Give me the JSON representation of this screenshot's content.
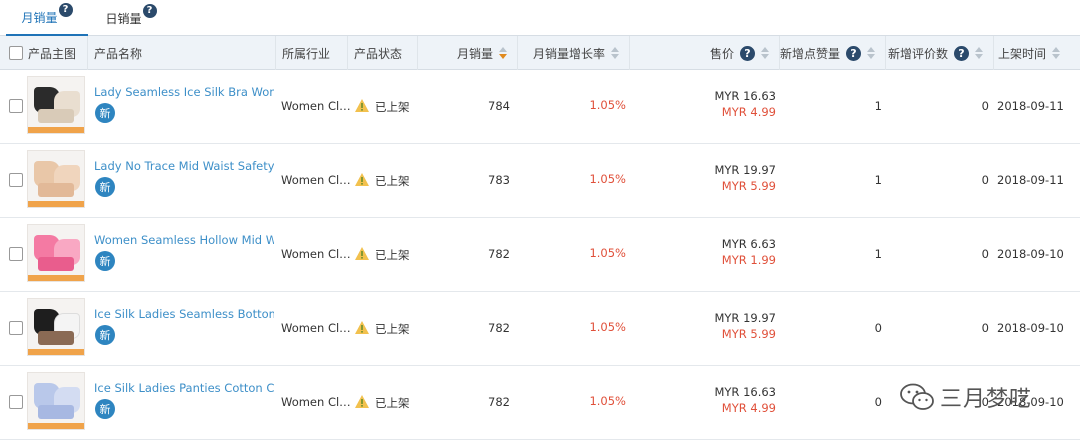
{
  "tabs": [
    {
      "label": "月销量",
      "active": true
    },
    {
      "label": "日销量",
      "active": false
    }
  ],
  "help_glyph": "?",
  "columns": {
    "image": "产品主图",
    "name": "产品名称",
    "industry": "所属行业",
    "status": "产品状态",
    "monthly_sales": "月销量",
    "growth": "月销量增长率",
    "price": "售价",
    "new_likes": "新增点赞量",
    "new_reviews": "新增评价数",
    "listed_date": "上架时间"
  },
  "new_badge": "新",
  "rows": [
    {
      "name": "Lady Seamless Ice Silk Bra Wom…",
      "industry": "Women Cl…",
      "status": "已上架",
      "sales": "784",
      "growth": "1.05%",
      "price": "MYR 16.63",
      "sale_price": "MYR 4.99",
      "likes": "1",
      "reviews": "0",
      "date": "2018-09-11"
    },
    {
      "name": "Lady No Trace Mid Waist Safety …",
      "industry": "Women Cl…",
      "status": "已上架",
      "sales": "783",
      "growth": "1.05%",
      "price": "MYR 19.97",
      "sale_price": "MYR 5.99",
      "likes": "1",
      "reviews": "0",
      "date": "2018-09-11"
    },
    {
      "name": "Women Seamless Hollow Mid W…",
      "industry": "Women Cl…",
      "status": "已上架",
      "sales": "782",
      "growth": "1.05%",
      "price": "MYR 6.63",
      "sale_price": "MYR 1.99",
      "likes": "1",
      "reviews": "0",
      "date": "2018-09-10"
    },
    {
      "name": "Ice Silk Ladies Seamless Bottom…",
      "industry": "Women Cl…",
      "status": "已上架",
      "sales": "782",
      "growth": "1.05%",
      "price": "MYR 19.97",
      "sale_price": "MYR 5.99",
      "likes": "0",
      "reviews": "0",
      "date": "2018-09-10"
    },
    {
      "name": "Ice Silk Ladies Panties Cotton Cr…",
      "industry": "Women Cl…",
      "status": "已上架",
      "sales": "782",
      "growth": "1.05%",
      "price": "MYR 16.63",
      "sale_price": "MYR 4.99",
      "likes": "0",
      "reviews": "0",
      "date": "2018-09-10"
    }
  ],
  "watermark": "三月梦呓",
  "colors": {
    "accent": "#1f73b7",
    "link": "#3d8fc8",
    "badge": "#2e85c0",
    "negative": "#e0503a",
    "header_bg": "#eef3f8",
    "sort_active": "#e08a1e"
  },
  "icons": {
    "tab_help": "question-circle-icon",
    "status": "warning-triangle-icon",
    "watermark": "wechat-icon"
  }
}
